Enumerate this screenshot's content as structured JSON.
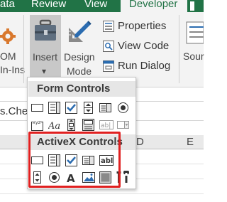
{
  "tabs": {
    "data_fragment": "ata",
    "review": "Review",
    "view": "View",
    "developer": "Developer"
  },
  "ribbon": {
    "left_label_line1": "OM",
    "left_label_line2": "In-Ins",
    "insert_line1": "Insert",
    "insert_arrow": "▾",
    "design_mode_line1": "Design",
    "design_mode_line2": "Mode",
    "properties": "Properties",
    "view_code": "View Code",
    "run_dialog": "Run Dialog",
    "source_fragment": "Sour"
  },
  "formula_bar": {
    "text_fragment": "s.Chec"
  },
  "column_headers": {
    "d_fragment": "D",
    "e": "E"
  },
  "dropdown": {
    "form_controls_heading": "Form Controls",
    "activex_controls_heading": "ActiveX Controls",
    "form_label_glyph": "Aa",
    "form_xyz_glyph": "xyz",
    "form_textfield_glyph": "ab|",
    "activex_textbox_glyph": "abl",
    "activex_label_glyph": "A"
  },
  "colors": {
    "excel_green": "#217346",
    "highlight_red": "#e02020",
    "accent_blue": "#2b6cb0"
  }
}
